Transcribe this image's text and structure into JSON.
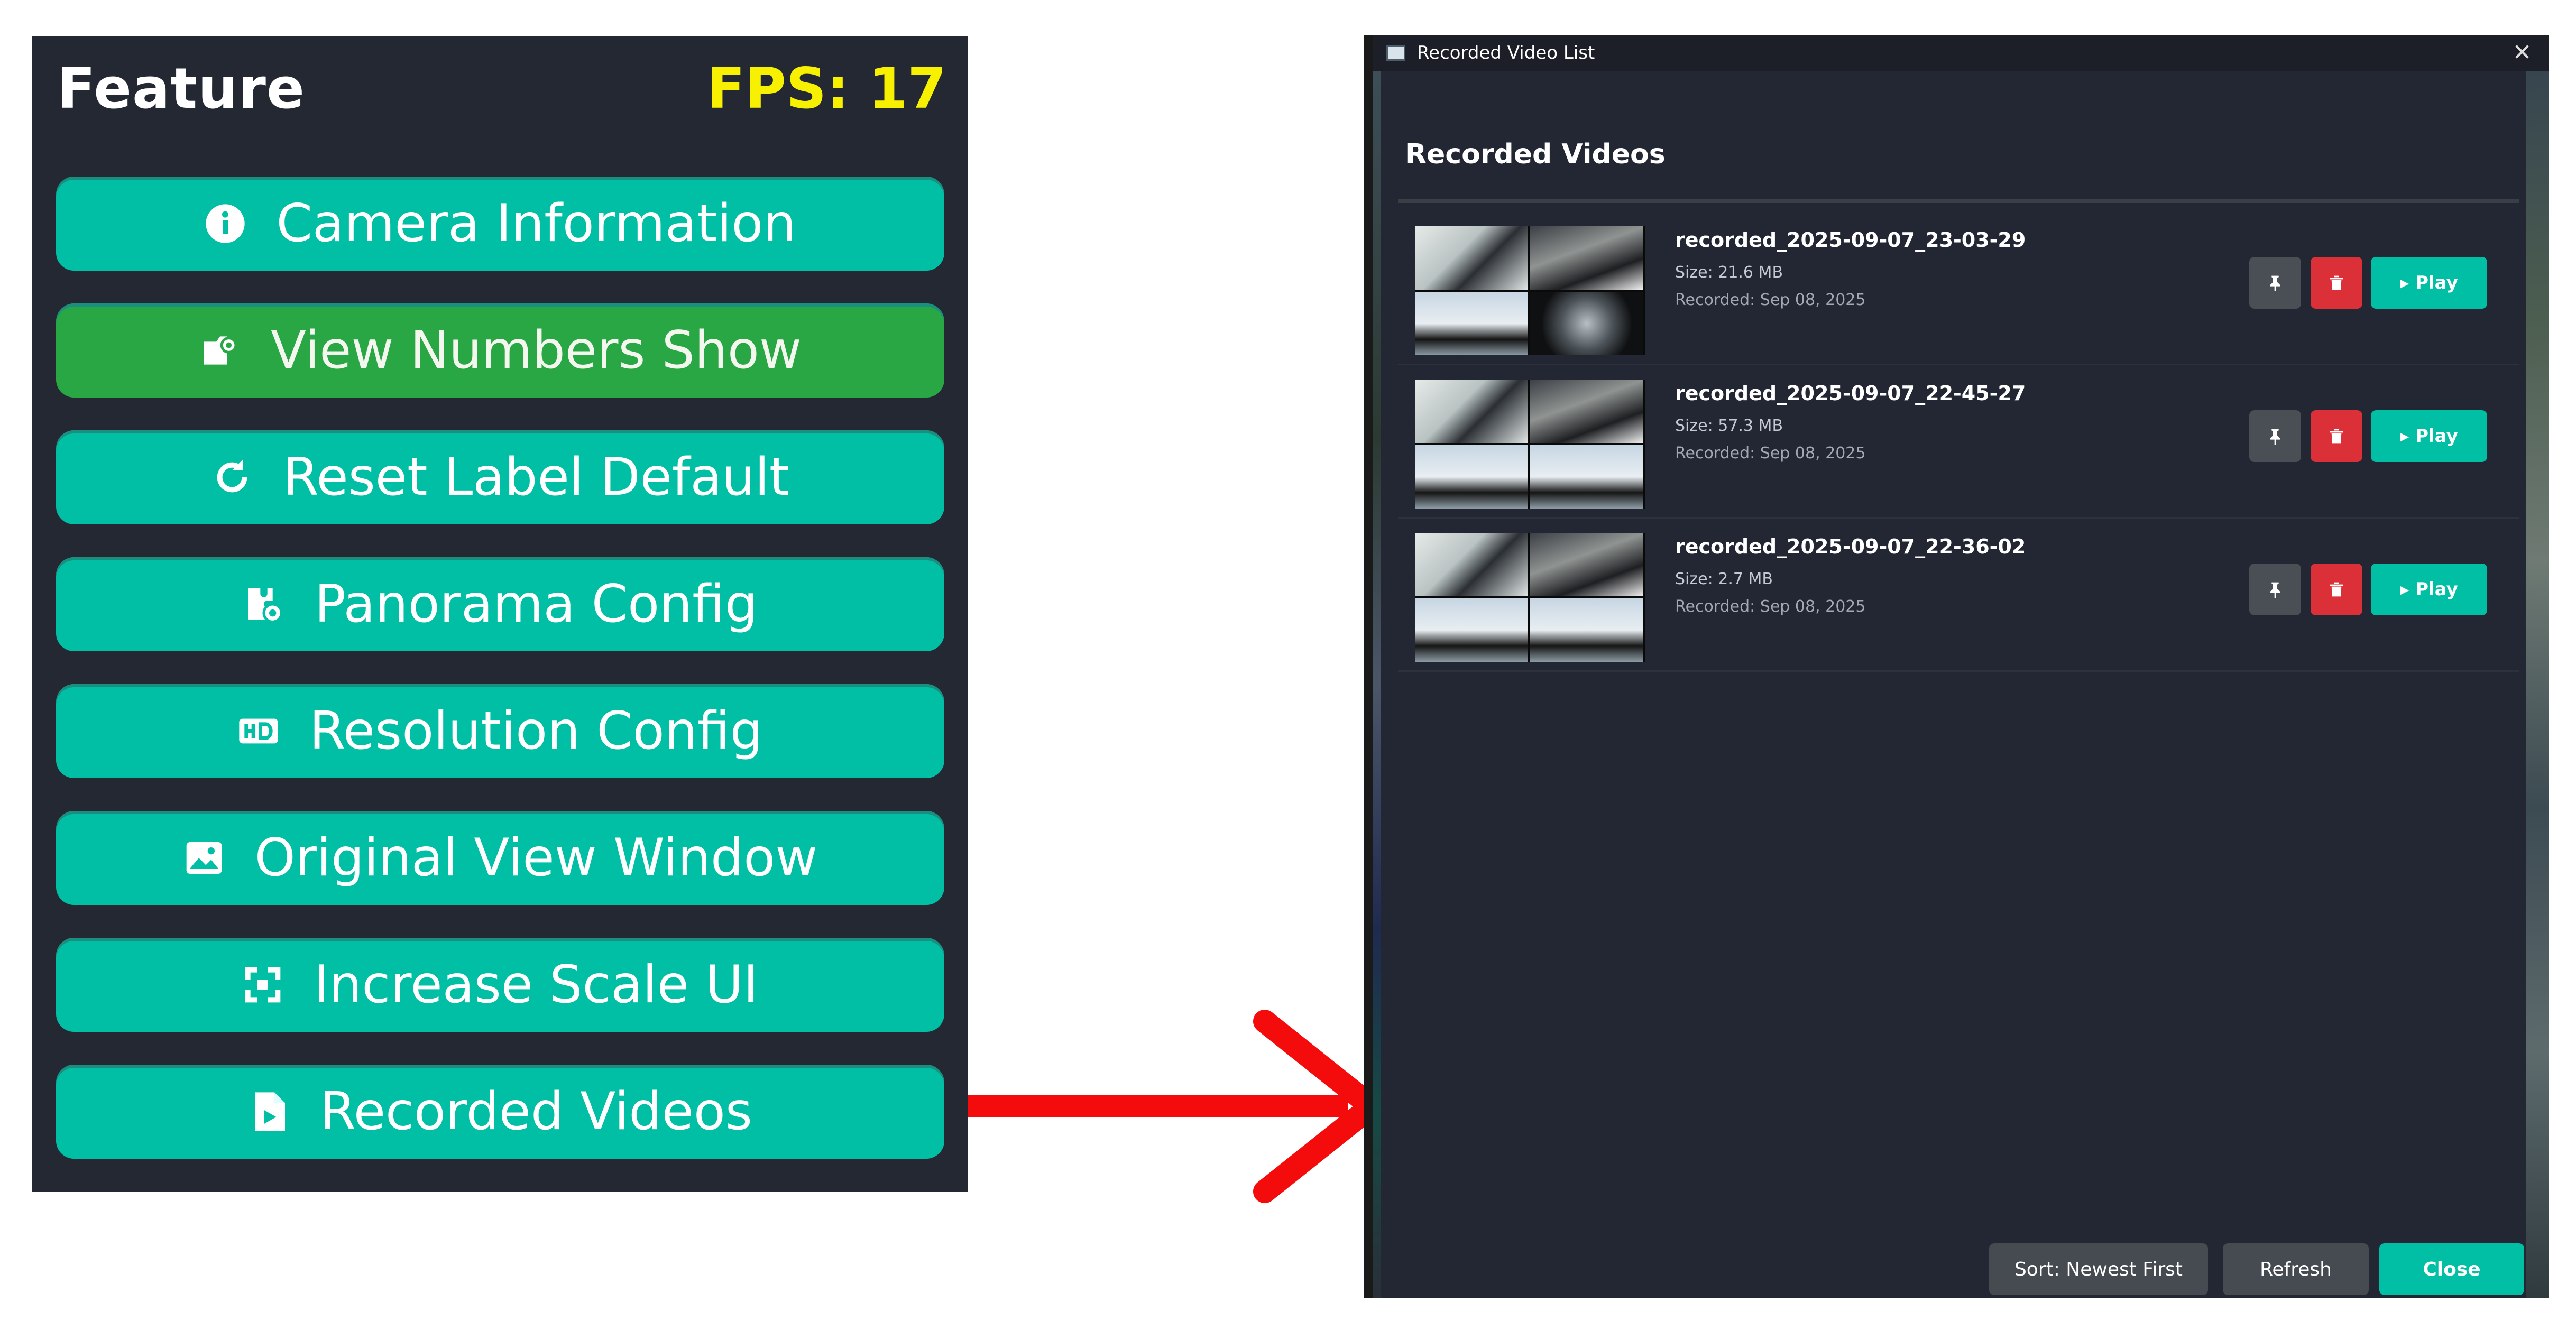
{
  "feature_panel": {
    "title": "Feature",
    "fps": "FPS: 17",
    "buttons": [
      {
        "label": "Camera Information",
        "icon": "info-icon"
      },
      {
        "label": "View Numbers Show",
        "icon": "id-card-icon"
      },
      {
        "label": "Reset Label Default",
        "icon": "refresh-icon"
      },
      {
        "label": "Panorama Config",
        "icon": "puzzle-gear-icon"
      },
      {
        "label": "Resolution Config",
        "icon": "hd-icon"
      },
      {
        "label": "Original View Window",
        "icon": "image-icon"
      },
      {
        "label": "Increase Scale UI",
        "icon": "expand-icon"
      },
      {
        "label": "Recorded Videos",
        "icon": "file-video-icon"
      }
    ],
    "colors": {
      "background": "#232833",
      "button": "#00bfa5",
      "active_button": "#28a744",
      "fps": "#f7f000"
    }
  },
  "arrow": {
    "color": "#f40b0b",
    "icon": "arrow-right-icon"
  },
  "dialog": {
    "window_title": "Recorded Video List",
    "heading": "Recorded Videos",
    "videos": [
      {
        "name": "recorded_2025-09-07_23-03-29",
        "size": "Size: 21.6 MB",
        "recorded": "Recorded: Sep 08, 2025"
      },
      {
        "name": "recorded_2025-09-07_22-45-27",
        "size": "Size: 57.3 MB",
        "recorded": "Recorded: Sep 08, 2025"
      },
      {
        "name": "recorded_2025-09-07_22-36-02",
        "size": "Size: 2.7 MB",
        "recorded": "Recorded: Sep 08, 2025"
      }
    ],
    "play_label": "▸ Play",
    "footer": {
      "sort": "Sort: Newest First",
      "refresh": "Refresh",
      "close": "Close"
    },
    "colors": {
      "background": "#222733",
      "delete": "#dc3038",
      "pin": "#4a4e55",
      "play": "#00bfa5"
    }
  }
}
